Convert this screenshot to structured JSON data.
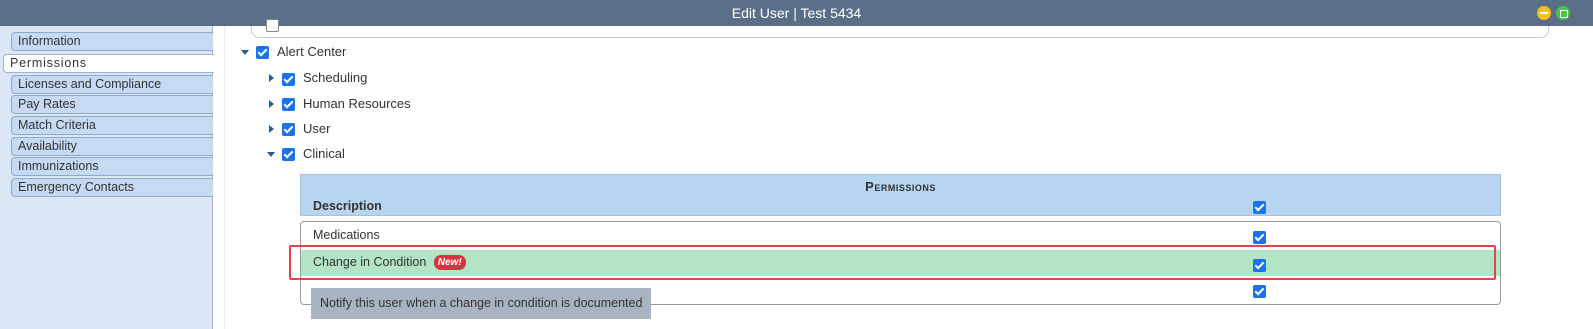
{
  "window": {
    "title": "Edit User | Test 5434"
  },
  "sidebar": {
    "items": [
      {
        "label": "Information"
      },
      {
        "label": "Permissions"
      },
      {
        "label": "Licenses and Compliance"
      },
      {
        "label": "Pay Rates"
      },
      {
        "label": "Match Criteria"
      },
      {
        "label": "Availability"
      },
      {
        "label": "Immunizations"
      },
      {
        "label": "Emergency Contacts"
      }
    ],
    "active": "Permissions"
  },
  "tree": {
    "root": {
      "label": "Alert Center",
      "checked": true,
      "expanded": true
    },
    "children": [
      {
        "label": "Scheduling",
        "checked": true,
        "expanded": false
      },
      {
        "label": "Human Resources",
        "checked": true,
        "expanded": false
      },
      {
        "label": "User",
        "checked": true,
        "expanded": false
      },
      {
        "label": "Clinical",
        "checked": true,
        "expanded": true
      }
    ]
  },
  "permissions_table": {
    "title": "Permissions",
    "column_description": "Description",
    "rows": [
      {
        "label": "Medications",
        "checked": true
      },
      {
        "label": "Change in Condition",
        "badge": "New!",
        "checked": true
      },
      {
        "label": "",
        "checked": true
      }
    ]
  },
  "tooltip": {
    "text": "Notify this user when a change in condition is documented"
  },
  "colors": {
    "titlebar": "#5a6f87",
    "sidebar_bg": "#dbe7f5",
    "header_bg": "#b7d4f1",
    "highlight_row": "#b3e4c6",
    "checkbox": "#1a73e8",
    "badge": "#d8343f",
    "annotation_box": "#e3434a"
  }
}
